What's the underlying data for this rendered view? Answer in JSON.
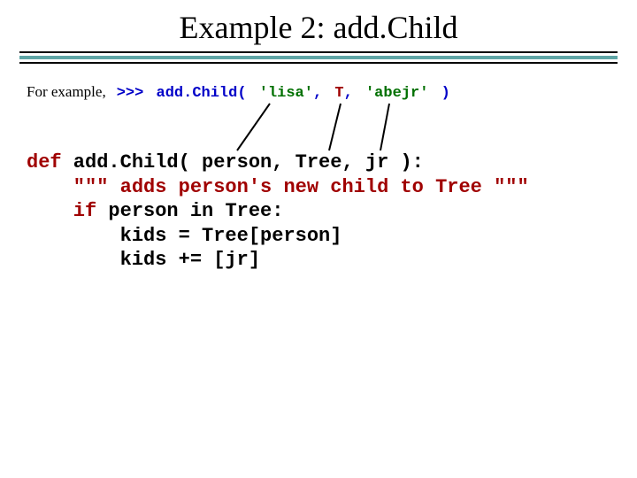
{
  "title": "Example 2: add.Child",
  "example": {
    "label": "For example,",
    "prompt": ">>>",
    "fn": "add.Child(",
    "arg1": "'lisa'",
    "comma1": ",",
    "arg2": "T",
    "comma2": ",",
    "arg3": "'abejr'",
    "close": ")"
  },
  "code": {
    "kw_def": "def",
    "fn_head": " add.Child( person, Tree, jr ):",
    "docline": "    \"\"\" adds person's new child to Tree \"\"\"",
    "ifline_kw": "    if",
    "ifline_rest": " person in Tree:",
    "l4": "        kids = Tree[person]",
    "l5": "        kids += [jr]"
  }
}
